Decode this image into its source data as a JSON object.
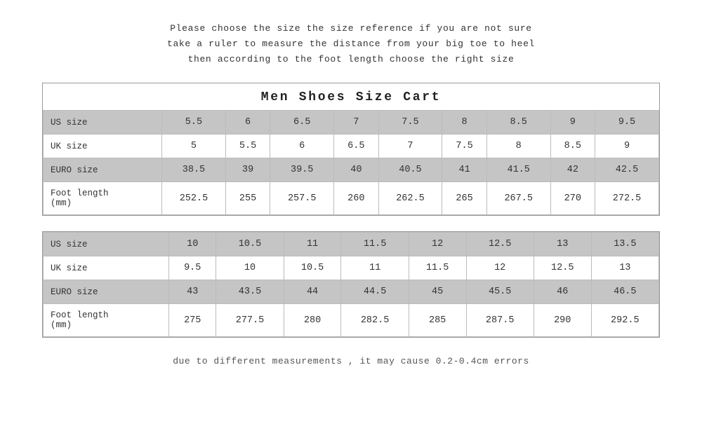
{
  "instruction": {
    "line1": "Please choose the size the size reference if you are not sure",
    "line2": "take a ruler to measure the distance from your big toe to heel",
    "line3": "then  according  to  the foot length  choose  the right size"
  },
  "table1": {
    "title": "Men   Shoes   Size   Cart",
    "rows": [
      {
        "label": "US size",
        "values": [
          "5.5",
          "6",
          "6.5",
          "7",
          "7.5",
          "8",
          "8.5",
          "9",
          "9.5"
        ],
        "shaded": true
      },
      {
        "label": "UK size",
        "values": [
          "5",
          "5.5",
          "6",
          "6.5",
          "7",
          "7.5",
          "8",
          "8.5",
          "9"
        ],
        "shaded": false
      },
      {
        "label": "EURO size",
        "values": [
          "38.5",
          "39",
          "39.5",
          "40",
          "40.5",
          "41",
          "41.5",
          "42",
          "42.5"
        ],
        "shaded": true
      },
      {
        "label": "Foot length\n(mm)",
        "values": [
          "252.5",
          "255",
          "257.5",
          "260",
          "262.5",
          "265",
          "267.5",
          "270",
          "272.5"
        ],
        "shaded": false
      }
    ]
  },
  "table2": {
    "rows": [
      {
        "label": "US size",
        "values": [
          "10",
          "10.5",
          "11",
          "11.5",
          "12",
          "12.5",
          "13",
          "13.5"
        ],
        "shaded": true
      },
      {
        "label": "UK size",
        "values": [
          "9.5",
          "10",
          "10.5",
          "11",
          "11.5",
          "12",
          "12.5",
          "13"
        ],
        "shaded": false
      },
      {
        "label": "EURO size",
        "values": [
          "43",
          "43.5",
          "44",
          "44.5",
          "45",
          "45.5",
          "46",
          "46.5"
        ],
        "shaded": true
      },
      {
        "label": "Foot length\n(mm)",
        "values": [
          "275",
          "277.5",
          "280",
          "282.5",
          "285",
          "287.5",
          "290",
          "292.5"
        ],
        "shaded": false
      }
    ]
  },
  "footer": "due to different measurements , it may cause 0.2-0.4cm errors"
}
